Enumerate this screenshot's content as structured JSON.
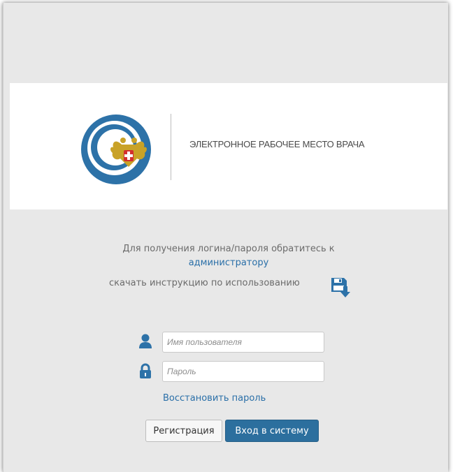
{
  "header": {
    "app_title": "ЭЛЕКТРОННОЕ РАБОЧЕЕ МЕСТО ВРАЧА",
    "logo_icon": "emblem-ring-logo-icon"
  },
  "info": {
    "line1": "Для получения логина/пароля обратитесь к",
    "admin_link": "администратору",
    "instruction_text": "скачать инструкцию по использованию",
    "download_icon": "floppy-download-icon"
  },
  "form": {
    "username_placeholder": "Имя пользователя",
    "password_placeholder": "Пароль",
    "user_icon": "user-icon",
    "lock_icon": "lock-icon",
    "restore_link": "Восстановить пароль",
    "register_label": "Регистрация",
    "login_label": "Вход в систему"
  },
  "colors": {
    "accent": "#2c6f9e",
    "link": "#2a6fa8",
    "background": "#e8e8e8"
  }
}
